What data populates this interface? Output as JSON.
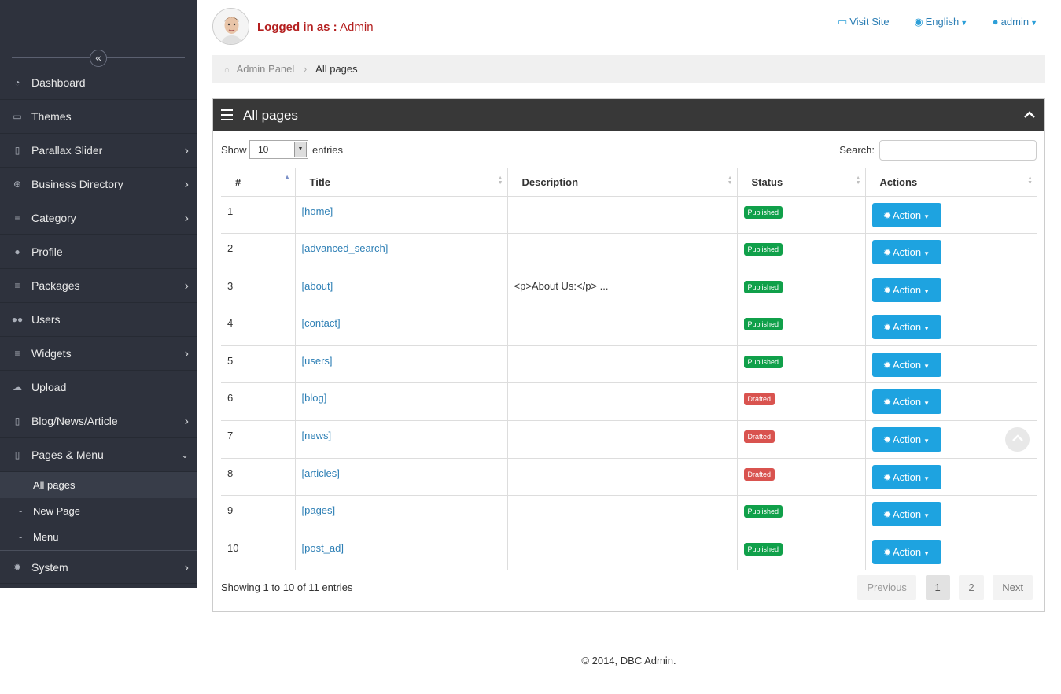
{
  "sidebar": {
    "items": [
      {
        "label": "Dashboard",
        "icon": "dashboard-icon"
      },
      {
        "label": "Themes",
        "icon": "monitor-icon"
      },
      {
        "label": "Parallax Slider",
        "icon": "file-icon",
        "has_children": true
      },
      {
        "label": "Business Directory",
        "icon": "plus-circle-icon",
        "has_children": true
      },
      {
        "label": "Category",
        "icon": "list-icon",
        "has_children": true
      },
      {
        "label": "Profile",
        "icon": "user-icon"
      },
      {
        "label": "Packages",
        "icon": "list-icon",
        "has_children": true
      },
      {
        "label": "Users",
        "icon": "users-icon"
      },
      {
        "label": "Widgets",
        "icon": "list-icon",
        "has_children": true
      },
      {
        "label": "Upload",
        "icon": "cloud-upload-icon"
      },
      {
        "label": "Blog/News/Article",
        "icon": "file-icon",
        "has_children": true
      },
      {
        "label": "Pages & Menu",
        "icon": "file-icon",
        "open": true
      },
      {
        "label": "System",
        "icon": "gear-icon",
        "has_children": true
      }
    ],
    "submenu": [
      {
        "label": "All pages",
        "active": true
      },
      {
        "label": "New Page",
        "dash": "-"
      },
      {
        "label": "Menu",
        "dash": "-"
      }
    ]
  },
  "header": {
    "logged_prefix": "Logged in as :",
    "logged_user": "Admin",
    "visit_site": "Visit Site",
    "language": "English",
    "user_menu": "admin"
  },
  "breadcrumb": {
    "root": "Admin Panel",
    "current": "All pages"
  },
  "panel": {
    "title": "All pages",
    "show_label": "Show",
    "page_size": "10",
    "entries_label": "entries",
    "search_label": "Search:",
    "search_value": "",
    "columns": [
      "#",
      "Title",
      "Description",
      "Status",
      "Actions"
    ],
    "rows": [
      {
        "num": "1",
        "title": "[home]",
        "description": "",
        "status": "Published",
        "status_type": "pub",
        "action": "Action"
      },
      {
        "num": "2",
        "title": "[advanced_search]",
        "description": "",
        "status": "Published",
        "status_type": "pub",
        "action": "Action"
      },
      {
        "num": "3",
        "title": "[about]",
        "description": "<p>About Us:</p> ...",
        "status": "Published",
        "status_type": "pub",
        "action": "Action"
      },
      {
        "num": "4",
        "title": "[contact]",
        "description": "",
        "status": "Published",
        "status_type": "pub",
        "action": "Action"
      },
      {
        "num": "5",
        "title": "[users]",
        "description": "",
        "status": "Published",
        "status_type": "pub",
        "action": "Action"
      },
      {
        "num": "6",
        "title": "[blog]",
        "description": "",
        "status": "Drafted",
        "status_type": "draft",
        "action": "Action"
      },
      {
        "num": "7",
        "title": "[news]",
        "description": "",
        "status": "Drafted",
        "status_type": "draft",
        "action": "Action"
      },
      {
        "num": "8",
        "title": "[articles]",
        "description": "",
        "status": "Drafted",
        "status_type": "draft",
        "action": "Action"
      },
      {
        "num": "9",
        "title": "[pages]",
        "description": "",
        "status": "Published",
        "status_type": "pub",
        "action": "Action"
      },
      {
        "num": "10",
        "title": "[post_ad]",
        "description": "",
        "status": "Published",
        "status_type": "pub",
        "action": "Action"
      }
    ],
    "info": "Showing 1 to 10 of 11 entries",
    "pager": {
      "previous": "Previous",
      "pages": [
        "1",
        "2"
      ],
      "next": "Next",
      "current": "1"
    }
  },
  "footer": {
    "copyright": "© 2014, DBC Admin."
  },
  "colors": {
    "sidebar_bg": "#2e323d",
    "accent": "#1ea3e0",
    "published": "#10a04a",
    "drafted": "#d9534f",
    "panel_head": "#383838"
  }
}
